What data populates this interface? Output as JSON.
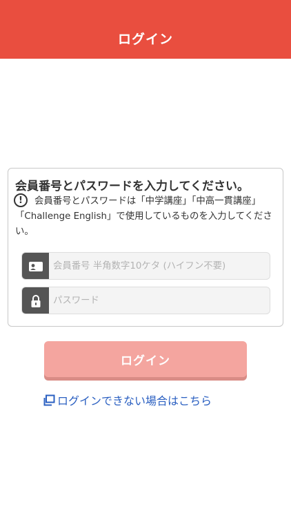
{
  "header": {
    "title": "ログイン"
  },
  "card": {
    "heading": "会員番号とパスワードを入力してください。",
    "notice_icon": "exclamation-circle-icon",
    "notice": "会員番号とパスワードは「中学講座」「中高一貫講座」「Challenge English」で使用しているものを入力してください。"
  },
  "fields": {
    "member_icon": "id-card-icon",
    "member_placeholder": "会員番号 半角数字10ケタ (ハイフン不要)",
    "member_value": "",
    "password_icon": "lock-icon",
    "password_placeholder": "パスワード",
    "password_value": ""
  },
  "login_button": {
    "label": "ログイン"
  },
  "help_link": {
    "icon": "external-window-icon",
    "label": "ログインできない場合はこちら"
  },
  "colors": {
    "header": "#e94e3f",
    "button": "#f4a59f",
    "link": "#2a5fc1",
    "icon_box": "#555555"
  }
}
